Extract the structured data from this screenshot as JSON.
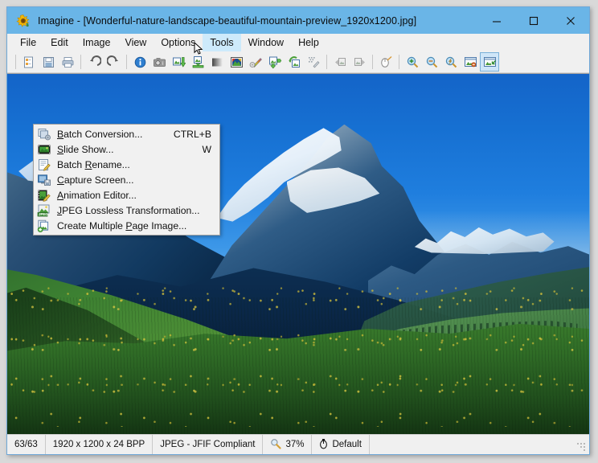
{
  "window": {
    "app_name": "Imagine",
    "title": "Imagine - [Wonderful-nature-landscape-beautiful-mountain-preview_1920x1200.jpg]",
    "app_icon": "sunflower-icon",
    "titlebar_color": "#6ab5e7",
    "controls": {
      "minimize": "minimize-icon",
      "maximize": "maximize-icon",
      "close": "close-icon"
    }
  },
  "menubar": {
    "items": [
      {
        "label": "File",
        "open": false
      },
      {
        "label": "Edit",
        "open": false
      },
      {
        "label": "Image",
        "open": false
      },
      {
        "label": "View",
        "open": false
      },
      {
        "label": "Options",
        "open": false
      },
      {
        "label": "Tools",
        "open": true
      },
      {
        "label": "Window",
        "open": false
      },
      {
        "label": "Help",
        "open": false
      }
    ],
    "highlight_color": "#cdeafb"
  },
  "tools_menu": {
    "open": true,
    "items": [
      {
        "label": "Batch Conversion...",
        "accel": "B",
        "shortcut": "CTRL+B",
        "icon": "batch-conversion-icon"
      },
      {
        "label": "Slide Show...",
        "accel": "S",
        "shortcut": "W",
        "icon": "slide-show-icon"
      },
      {
        "label": "Batch Rename...",
        "accel": "R",
        "shortcut": "",
        "icon": "batch-rename-icon"
      },
      {
        "label": "Capture Screen...",
        "accel": "C",
        "shortcut": "",
        "icon": "capture-screen-icon"
      },
      {
        "label": "Animation Editor...",
        "accel": "A",
        "shortcut": "",
        "icon": "animation-editor-icon"
      },
      {
        "label": "JPEG Lossless Transformation...",
        "accel": "J",
        "shortcut": "",
        "icon": "jpeg-lossless-icon"
      },
      {
        "label": "Create Multiple Page Image...",
        "accel": "P",
        "shortcut": "",
        "icon": "create-multipage-icon"
      }
    ]
  },
  "toolbar": {
    "buttons": [
      {
        "name": "open-file-icon",
        "group": 0
      },
      {
        "name": "save-file-icon",
        "group": 0
      },
      {
        "name": "print-icon",
        "group": 0
      },
      {
        "name": "undo-icon",
        "group": 1
      },
      {
        "name": "redo-icon",
        "group": 1
      },
      {
        "name": "image-info-icon",
        "group": 2
      },
      {
        "name": "camera-icon",
        "group": 2
      },
      {
        "name": "import-image-icon",
        "group": 2
      },
      {
        "name": "export-image-icon",
        "group": 2
      },
      {
        "name": "gradient-icon",
        "group": 2
      },
      {
        "name": "color-adjust-icon",
        "group": 3
      },
      {
        "name": "effects-icon",
        "group": 3
      },
      {
        "name": "color-depth-icon",
        "group": 3
      },
      {
        "name": "rotate-icon",
        "group": 3
      },
      {
        "name": "dither-icon",
        "group": 3
      },
      {
        "name": "previous-image-icon",
        "group": 4
      },
      {
        "name": "next-image-icon",
        "group": 4
      },
      {
        "name": "mouse-mode-icon",
        "group": 5
      },
      {
        "name": "zoom-in-icon",
        "group": 6
      },
      {
        "name": "zoom-out-icon",
        "group": 6
      },
      {
        "name": "zoom-actual-icon",
        "group": 6
      },
      {
        "name": "fit-window-icon",
        "group": 6
      },
      {
        "name": "fit-image-icon",
        "group": 6,
        "selected": true
      }
    ]
  },
  "statusbar": {
    "page_counter": "63/63",
    "dimensions": "1920 x 1200 x 24 BPP",
    "format": "JPEG - JFIF Compliant",
    "zoom_icon": "magnifier-icon",
    "zoom_level": "37%",
    "mouse_icon": "mouse-icon",
    "mouse_mode": "Default"
  },
  "image": {
    "subject": "snow-capped mountain with green alpine meadow",
    "sky_color": "#1670d2",
    "grass_color": "#3d8132",
    "snow_color": "#ffffff"
  }
}
